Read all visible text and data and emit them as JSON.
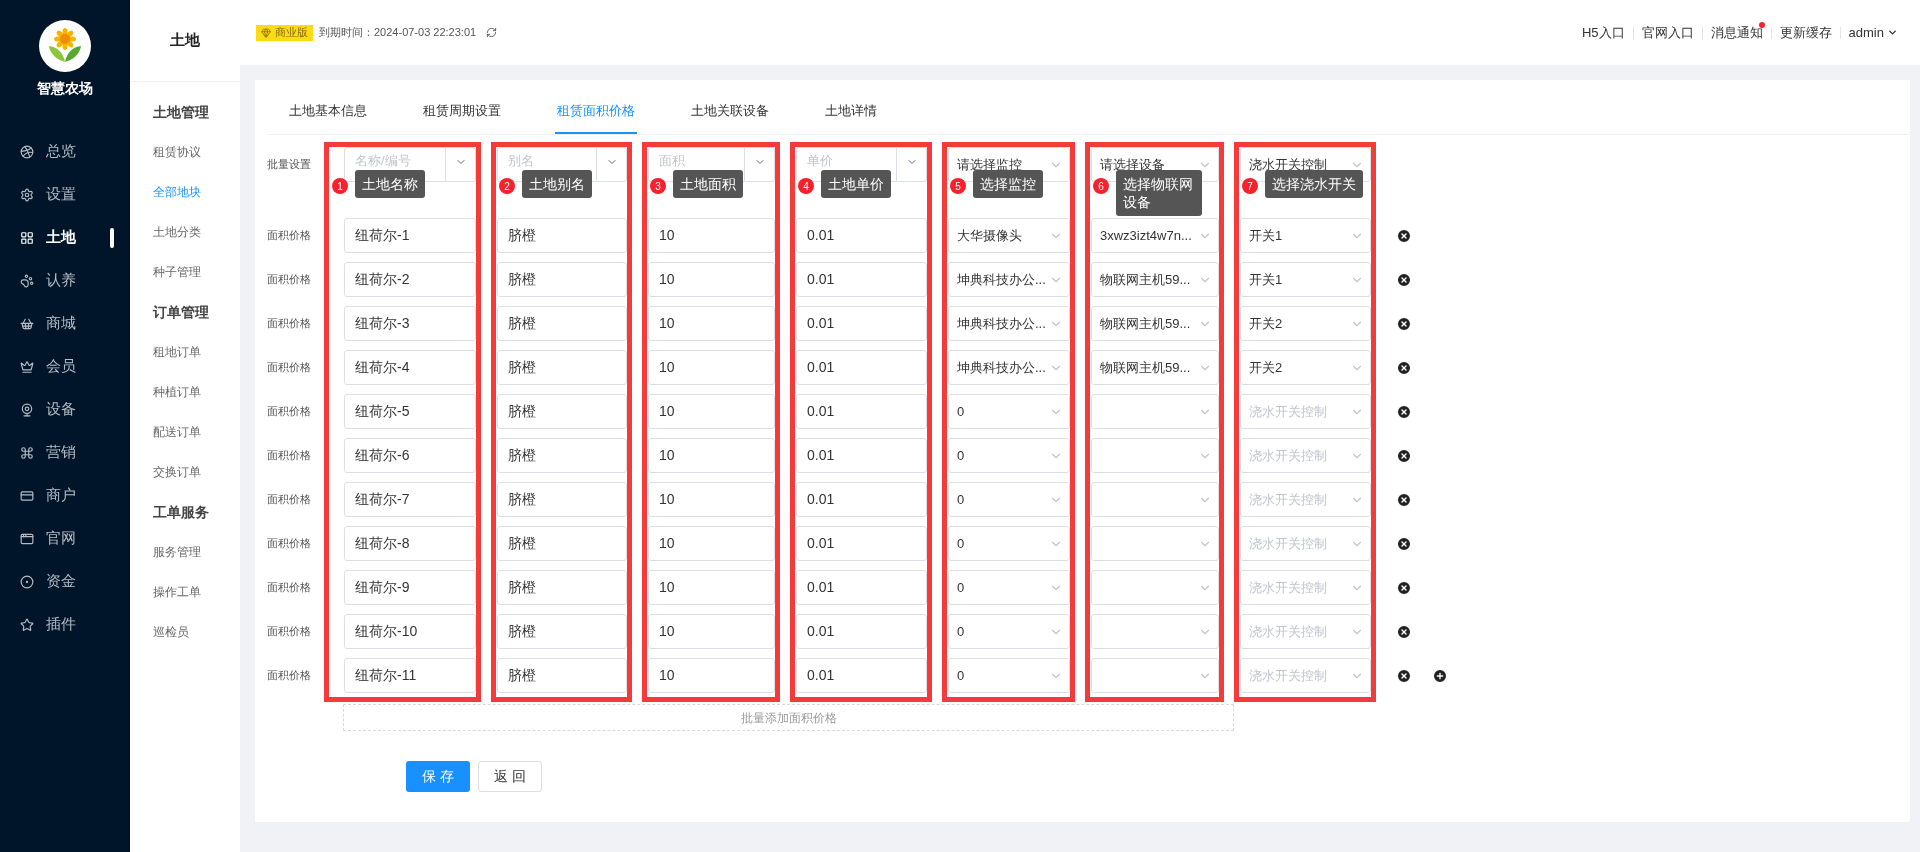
{
  "brand": {
    "name": "智慧农场"
  },
  "nav": [
    {
      "label": "总览",
      "selected": false
    },
    {
      "label": "设置",
      "selected": false
    },
    {
      "label": "土地",
      "selected": true
    },
    {
      "label": "认养",
      "selected": false
    },
    {
      "label": "商城",
      "selected": false
    },
    {
      "label": "会员",
      "selected": false
    },
    {
      "label": "设备",
      "selected": false
    },
    {
      "label": "营销",
      "selected": false
    },
    {
      "label": "商户",
      "selected": false
    },
    {
      "label": "官网",
      "selected": false
    },
    {
      "label": "资金",
      "selected": false
    },
    {
      "label": "插件",
      "selected": false
    }
  ],
  "subnav": {
    "title": "土地",
    "groups": [
      {
        "heading": "土地管理",
        "items": [
          {
            "label": "租赁协议",
            "selected": false
          },
          {
            "label": "全部地块",
            "selected": true
          },
          {
            "label": "土地分类",
            "selected": false
          },
          {
            "label": "种子管理",
            "selected": false
          }
        ]
      },
      {
        "heading": "订单管理",
        "items": [
          {
            "label": "租地订单",
            "selected": false
          },
          {
            "label": "种植订单",
            "selected": false
          },
          {
            "label": "配送订单",
            "selected": false
          },
          {
            "label": "交换订单",
            "selected": false
          }
        ]
      },
      {
        "heading": "工单服务",
        "items": [
          {
            "label": "服务管理",
            "selected": false
          },
          {
            "label": "操作工单",
            "selected": false
          },
          {
            "label": "巡检员",
            "selected": false
          }
        ]
      }
    ]
  },
  "header": {
    "edition": "商业版",
    "expiry": "到期时间：2024-07-03 22:23:01",
    "links": [
      {
        "label": "H5入口",
        "notification": false
      },
      {
        "label": "官网入口",
        "notification": false
      },
      {
        "label": "消息通知",
        "notification": true
      },
      {
        "label": "更新缓存",
        "notification": false
      }
    ],
    "user": "admin"
  },
  "tabs": [
    {
      "label": "土地基本信息",
      "selected": false
    },
    {
      "label": "租赁周期设置",
      "selected": false
    },
    {
      "label": "租赁面积价格",
      "selected": true
    },
    {
      "label": "土地关联设备",
      "selected": false
    },
    {
      "label": "土地详情",
      "selected": false
    }
  ],
  "batch_label": "批量设置",
  "columns": [
    {
      "number": "1",
      "callout": "土地名称",
      "kind": "input",
      "placeholder": "名称/编号"
    },
    {
      "number": "2",
      "callout": "土地别名",
      "kind": "input",
      "placeholder": "别名"
    },
    {
      "number": "3",
      "callout": "土地面积",
      "kind": "input",
      "placeholder": "面积"
    },
    {
      "number": "4",
      "callout": "土地单价",
      "kind": "input",
      "placeholder": "单价"
    },
    {
      "number": "5",
      "callout": "选择监控",
      "kind": "select",
      "value": "请选择监控"
    },
    {
      "number": "6",
      "callout": "选择物联网设备",
      "kind": "select",
      "value": "请选择设备"
    },
    {
      "number": "7",
      "callout": "选择浇水开关",
      "kind": "select",
      "value": "浇水开关控制"
    }
  ],
  "rows": [
    {
      "label": "面积价格",
      "cells": [
        {
          "value": "纽荷尔-1"
        },
        {
          "value": "脐橙"
        },
        {
          "value": "10"
        },
        {
          "value": "0.01"
        },
        {
          "value": "大华摄像头"
        },
        {
          "value": "3xwz3izt4w7n..."
        },
        {
          "value": "开关1"
        }
      ]
    },
    {
      "label": "面积价格",
      "cells": [
        {
          "value": "纽荷尔-2"
        },
        {
          "value": "脐橙"
        },
        {
          "value": "10"
        },
        {
          "value": "0.01"
        },
        {
          "value": "坤典科技办公..."
        },
        {
          "value": "物联网主机59..."
        },
        {
          "value": "开关1"
        }
      ]
    },
    {
      "label": "面积价格",
      "cells": [
        {
          "value": "纽荷尔-3"
        },
        {
          "value": "脐橙"
        },
        {
          "value": "10"
        },
        {
          "value": "0.01"
        },
        {
          "value": "坤典科技办公..."
        },
        {
          "value": "物联网主机59..."
        },
        {
          "value": "开关2"
        }
      ]
    },
    {
      "label": "面积价格",
      "cells": [
        {
          "value": "纽荷尔-4"
        },
        {
          "value": "脐橙"
        },
        {
          "value": "10"
        },
        {
          "value": "0.01"
        },
        {
          "value": "坤典科技办公..."
        },
        {
          "value": "物联网主机59..."
        },
        {
          "value": "开关2"
        }
      ]
    },
    {
      "label": "面积价格",
      "cells": [
        {
          "value": "纽荷尔-5"
        },
        {
          "value": "脐橙"
        },
        {
          "value": "10"
        },
        {
          "value": "0.01"
        },
        {
          "value": "0"
        },
        {},
        {
          "placeholder": "浇水开关控制"
        }
      ]
    },
    {
      "label": "面积价格",
      "cells": [
        {
          "value": "纽荷尔-6"
        },
        {
          "value": "脐橙"
        },
        {
          "value": "10"
        },
        {
          "value": "0.01"
        },
        {
          "value": "0"
        },
        {},
        {
          "placeholder": "浇水开关控制"
        }
      ]
    },
    {
      "label": "面积价格",
      "cells": [
        {
          "value": "纽荷尔-7"
        },
        {
          "value": "脐橙"
        },
        {
          "value": "10"
        },
        {
          "value": "0.01"
        },
        {
          "value": "0"
        },
        {},
        {
          "placeholder": "浇水开关控制"
        }
      ]
    },
    {
      "label": "面积价格",
      "cells": [
        {
          "value": "纽荷尔-8"
        },
        {
          "value": "脐橙"
        },
        {
          "value": "10"
        },
        {
          "value": "0.01"
        },
        {
          "value": "0"
        },
        {},
        {
          "placeholder": "浇水开关控制"
        }
      ]
    },
    {
      "label": "面积价格",
      "cells": [
        {
          "value": "纽荷尔-9"
        },
        {
          "value": "脐橙"
        },
        {
          "value": "10"
        },
        {
          "value": "0.01"
        },
        {
          "value": "0"
        },
        {},
        {
          "placeholder": "浇水开关控制"
        }
      ]
    },
    {
      "label": "面积价格",
      "cells": [
        {
          "value": "纽荷尔-10"
        },
        {
          "value": "脐橙"
        },
        {
          "value": "10"
        },
        {
          "value": "0.01"
        },
        {
          "value": "0"
        },
        {},
        {
          "placeholder": "浇水开关控制"
        }
      ]
    },
    {
      "label": "面积价格",
      "cells": [
        {
          "value": "纽荷尔-11"
        },
        {
          "value": "脐橙"
        },
        {
          "value": "10"
        },
        {
          "value": "0.01"
        },
        {
          "value": "0"
        },
        {},
        {
          "placeholder": "浇水开关控制"
        }
      ]
    }
  ],
  "batch_add": "批量添加面积价格",
  "buttons": [
    {
      "label": "保 存",
      "kind": "primary"
    },
    {
      "label": "返 回",
      "kind": "default"
    }
  ]
}
